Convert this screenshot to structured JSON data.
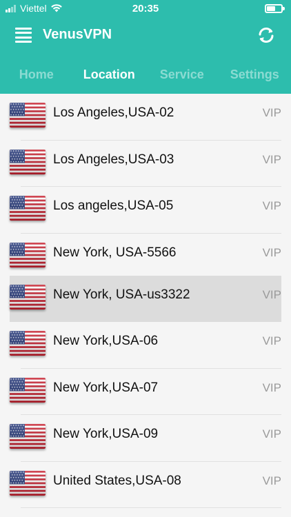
{
  "status_bar": {
    "carrier": "Viettel",
    "time": "20:35"
  },
  "header": {
    "app_title": "VenusVPN"
  },
  "tabs": [
    {
      "label": "Home",
      "active": false
    },
    {
      "label": "Location",
      "active": true
    },
    {
      "label": "Service",
      "active": false
    },
    {
      "label": "Settings",
      "active": false
    }
  ],
  "servers": [
    {
      "name": "Los Angeles,USA-02",
      "badge": "VIP",
      "selected": false
    },
    {
      "name": "Los Angeles,USA-03",
      "badge": "VIP",
      "selected": false
    },
    {
      "name": "Los angeles,USA-05",
      "badge": "VIP",
      "selected": false
    },
    {
      "name": "New York, USA-5566",
      "badge": "VIP",
      "selected": false
    },
    {
      "name": "New York, USA-us3322",
      "badge": "VIP",
      "selected": true
    },
    {
      "name": "New York,USA-06",
      "badge": "VIP",
      "selected": false
    },
    {
      "name": "New York,USA-07",
      "badge": "VIP",
      "selected": false
    },
    {
      "name": "New York,USA-09",
      "badge": "VIP",
      "selected": false
    },
    {
      "name": "United States,USA-08",
      "badge": "VIP",
      "selected": false
    }
  ],
  "colors": {
    "accent": "#2dbdad",
    "selected_row": "#dcdcdc",
    "vip_text": "#9a9a9a"
  },
  "icons": {
    "menu": "hamburger-icon",
    "refresh": "refresh-icon",
    "flag": "us-flag-icon"
  }
}
